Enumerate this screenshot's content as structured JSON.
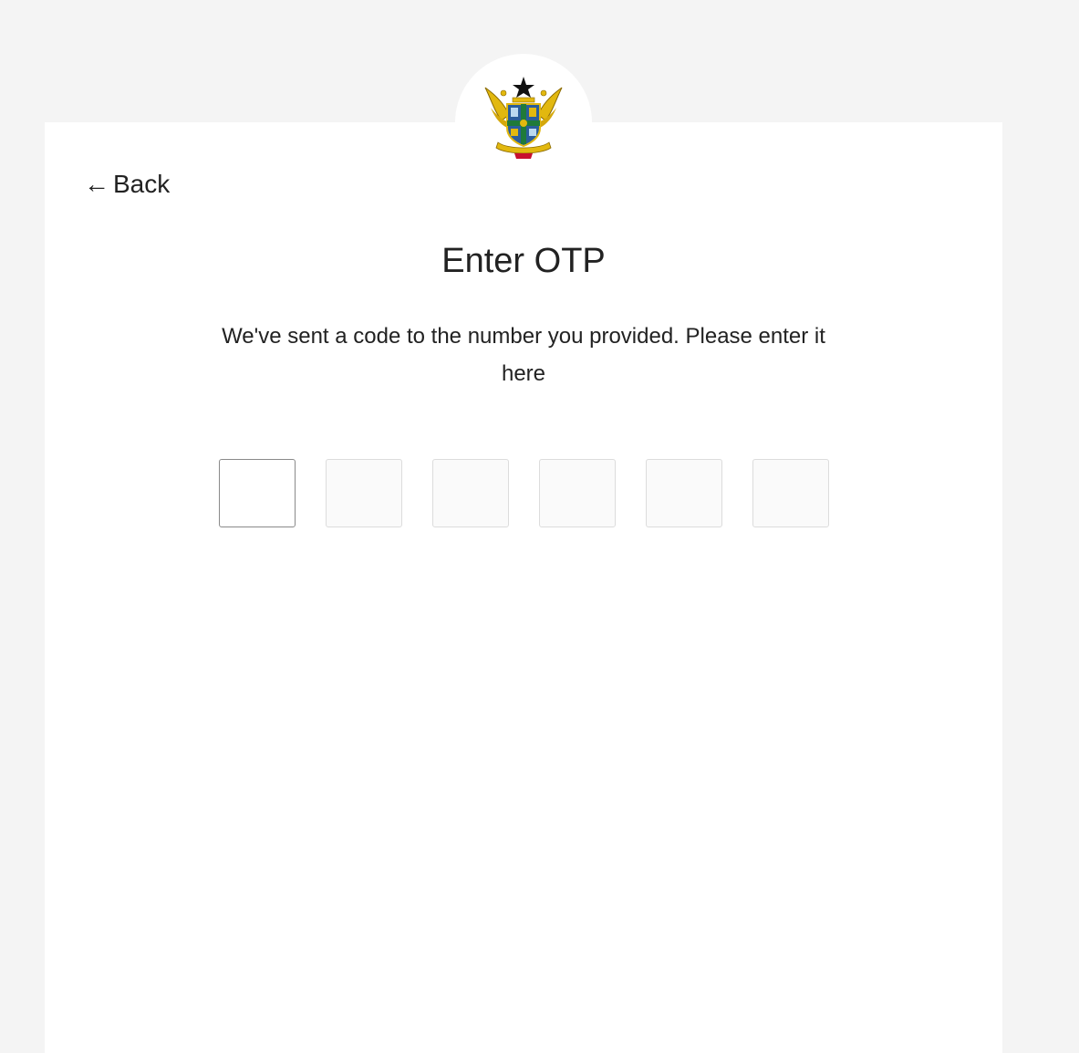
{
  "navigation": {
    "back_label": "Back",
    "back_arrow": "←"
  },
  "header": {
    "emblem_icon": "coat-of-arms-icon"
  },
  "content": {
    "title": "Enter OTP",
    "description": "We've sent a code to the number you provided. Please enter it here"
  },
  "otp": {
    "digits": [
      {
        "value": "",
        "active": true
      },
      {
        "value": "",
        "active": false
      },
      {
        "value": "",
        "active": false
      },
      {
        "value": "",
        "active": false
      },
      {
        "value": "",
        "active": false
      },
      {
        "value": "",
        "active": false
      }
    ]
  },
  "colors": {
    "background": "#f4f4f4",
    "card": "#ffffff",
    "text": "#222222",
    "emblem_gold": "#e2b80f",
    "emblem_green": "#1f7a3a",
    "emblem_blue": "#2a5d9c",
    "emblem_red": "#c8102e"
  }
}
